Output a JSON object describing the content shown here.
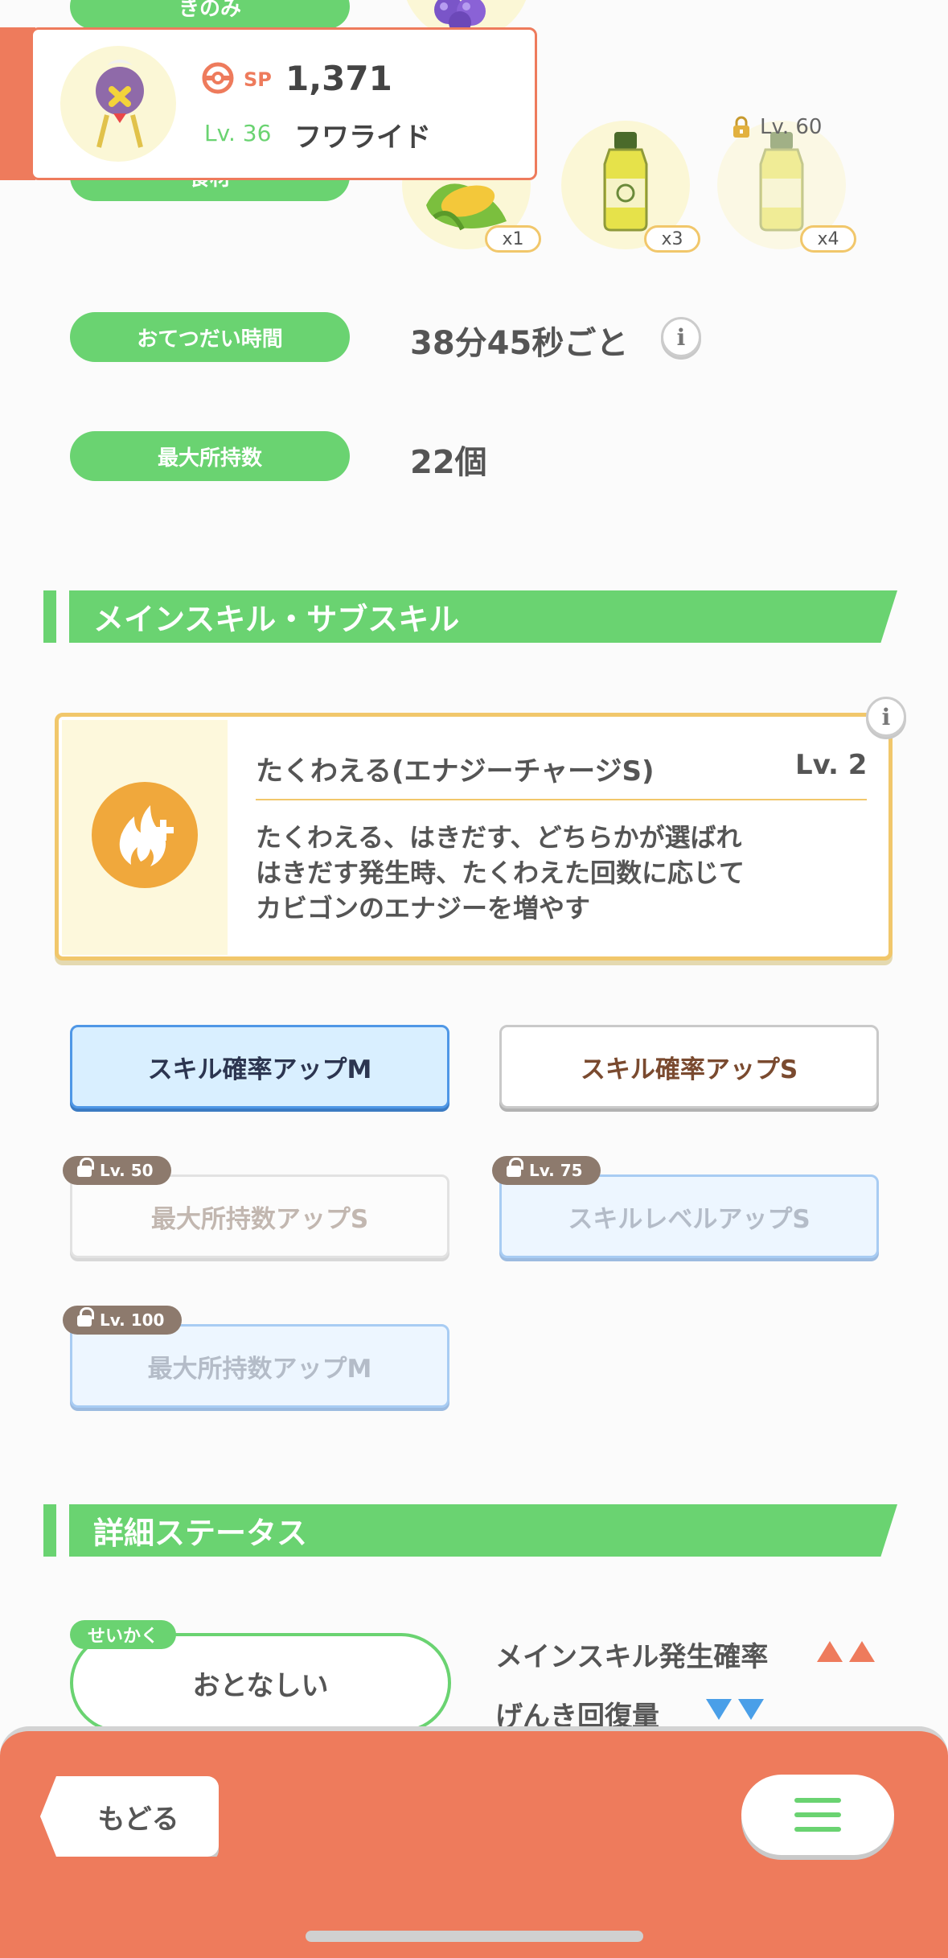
{
  "header_card": {
    "sp_label": "SP",
    "sp_value": "1,371",
    "level": "Lv. 36",
    "pokemon_name": "フワライド"
  },
  "stats": {
    "partial_label_top": "きのみ",
    "partial_label_ingredient": "食材",
    "help_time_label": "おてつだい時間",
    "help_time_value": "38分45秒ごと",
    "max_carry_label": "最大所持数",
    "max_carry_value": "22個"
  },
  "ingredients": [
    {
      "name": "corn",
      "count": "x1"
    },
    {
      "name": "oil",
      "count": "x3"
    },
    {
      "name": "oil",
      "count": "x4",
      "lock": "Lv. 60"
    }
  ],
  "skills_section": {
    "title": "メインスキル・サブスキル",
    "main_skill": {
      "name": "たくわえる(エナジーチャージS)",
      "level": "Lv. 2",
      "desc_1": "たくわえる、はきだす、どちらかが選ばれ",
      "desc_2": "はきだす発生時、たくわえた回数に応じて",
      "desc_3": "カビゴンのエナジーを増やす"
    },
    "sub_skills": [
      {
        "label": "スキル確率アップM",
        "lock": ""
      },
      {
        "label": "スキル確率アップS",
        "lock": ""
      },
      {
        "label": "最大所持数アップS",
        "lock": "Lv. 50"
      },
      {
        "label": "スキルレベルアップS",
        "lock": "Lv. 75"
      },
      {
        "label": "最大所持数アップM",
        "lock": "Lv. 100"
      }
    ]
  },
  "detail_section": {
    "title": "詳細ステータス",
    "nature_tag": "せいかく",
    "nature_value": "おとなしい",
    "up_stat": "メインスキル発生確率",
    "down_stat": "げんき回復量"
  },
  "bottom_bar": {
    "back_label": "もどる"
  },
  "colors": {
    "green": "#6ad371",
    "orange": "#ee7b5c",
    "skill_orange": "#f0a83c",
    "up_arrow": "#ee7b5c",
    "down_arrow": "#4a9fe8"
  }
}
